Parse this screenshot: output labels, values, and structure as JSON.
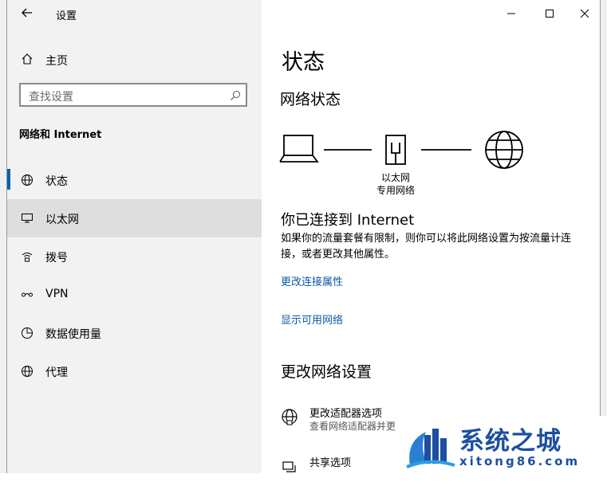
{
  "window": {
    "app_title": "设置",
    "back_icon": "back-arrow-icon",
    "controls": [
      "minimize-icon",
      "maximize-icon",
      "close-icon"
    ]
  },
  "sidebar": {
    "home_label": "主页",
    "search_placeholder": "查找设置",
    "section_title": "网络和 Internet",
    "items": [
      {
        "label": "状态",
        "icon": "status-globe-icon",
        "selected": false
      },
      {
        "label": "以太网",
        "icon": "ethernet-icon",
        "selected": true
      },
      {
        "label": "拨号",
        "icon": "dialup-icon",
        "selected": false
      },
      {
        "label": "VPN",
        "icon": "vpn-icon",
        "selected": false
      },
      {
        "label": "数据使用量",
        "icon": "data-usage-icon",
        "selected": false
      },
      {
        "label": "代理",
        "icon": "proxy-globe-icon",
        "selected": false
      }
    ],
    "accent_color": "#0063b1"
  },
  "main": {
    "title": "状态",
    "network_status_heading": "网络状态",
    "diagram_label_line1": "以太网",
    "diagram_label_line2": "专用网络",
    "connected_heading": "你已连接到 Internet",
    "description": "如果你的流量套餐有限制，则你可以将此网络设置为按流量计连接，或者更改其他属性。",
    "link_change_props": "更改连接属性",
    "link_show_networks": "显示可用网络",
    "change_settings_heading": "更改网络设置",
    "options": [
      {
        "title": "更改适配器选项",
        "subtitle": "查看网络适配器并更",
        "icon": "adapter-globe-icon"
      },
      {
        "title": "共享选项",
        "subtitle": "",
        "icon": "sharing-icon"
      }
    ],
    "link_color": "#0b58a8"
  },
  "watermark": {
    "title": "系统之城",
    "url": "xitong86.com"
  }
}
